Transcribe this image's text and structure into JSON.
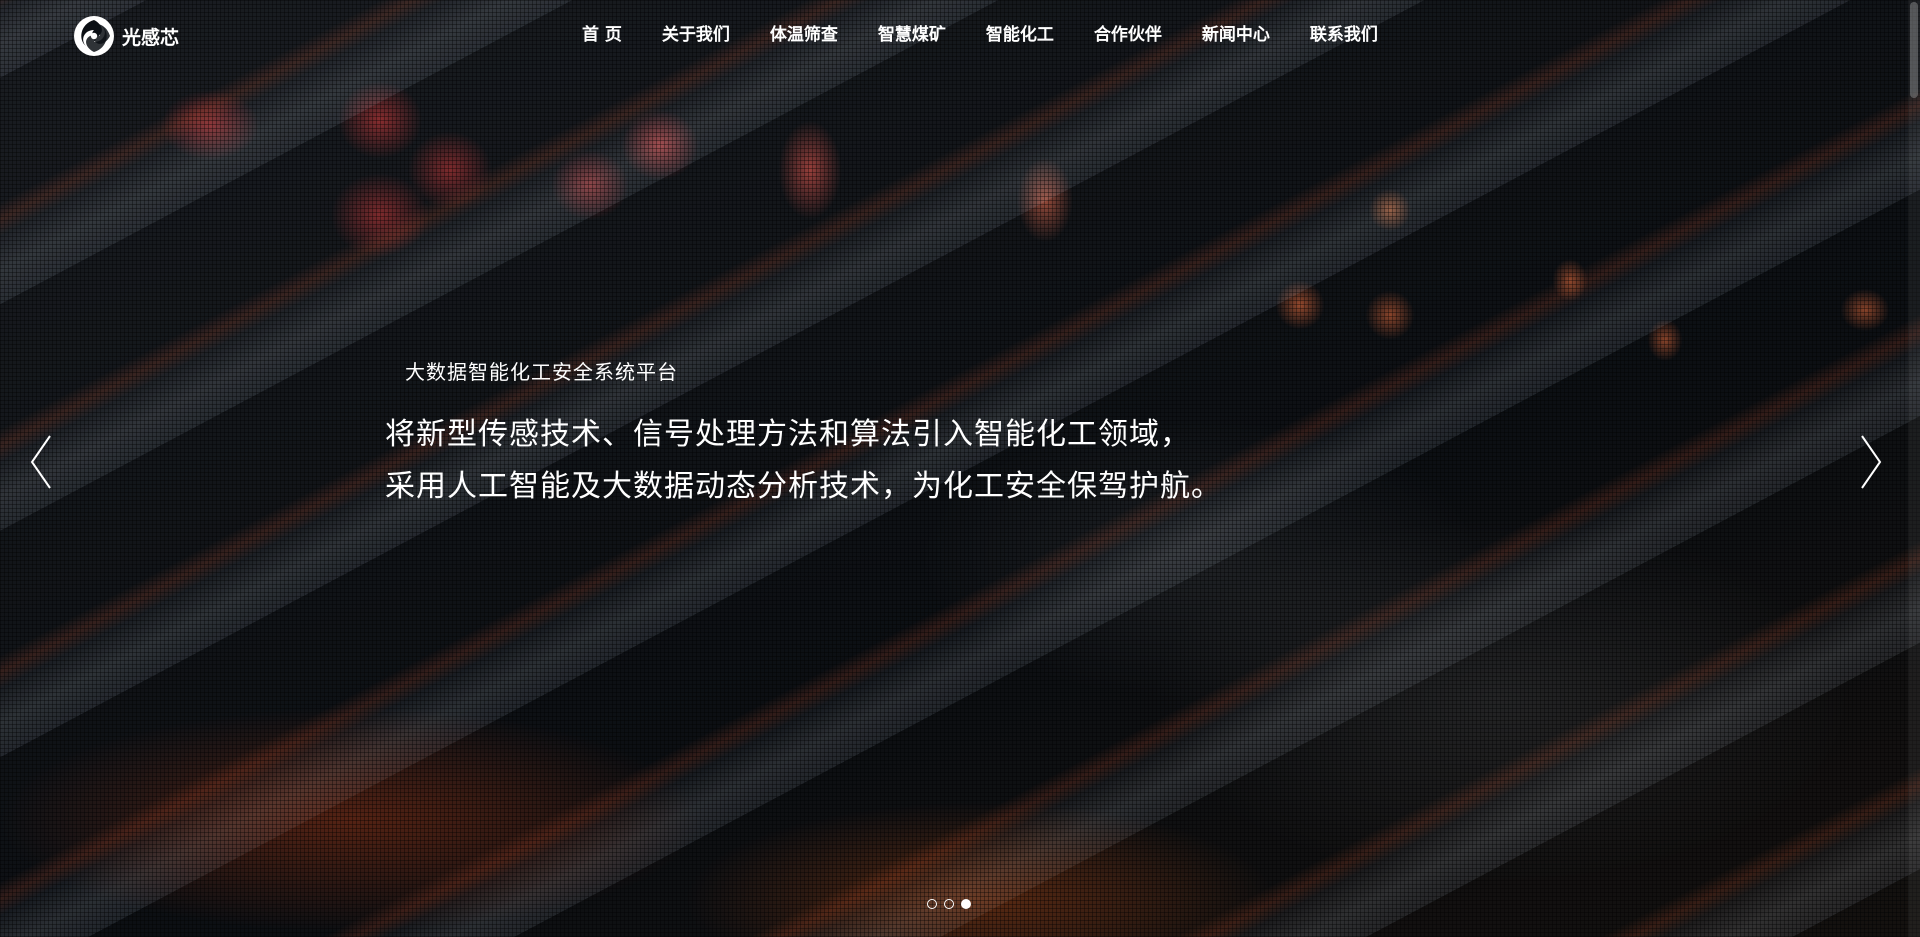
{
  "brand": {
    "name": "光感芯"
  },
  "nav": {
    "items": [
      {
        "label": "首 页"
      },
      {
        "label": "关于我们"
      },
      {
        "label": "体温筛查"
      },
      {
        "label": "智慧煤矿"
      },
      {
        "label": "智能化工"
      },
      {
        "label": "合作伙伴"
      },
      {
        "label": "新闻中心"
      },
      {
        "label": "联系我们"
      }
    ]
  },
  "hero": {
    "subtitle": "大数据智能化工安全系统平台",
    "headline_line1": "将新型传感技术、信号处理方法和算法引入智能化工领域，",
    "headline_line2": "采用人工智能及大数据动态分析技术，为化工安全保驾护航。",
    "prev_icon": "chevron-left-icon",
    "next_icon": "chevron-right-icon"
  },
  "carousel": {
    "slide_count": 3,
    "active_index": 3
  },
  "colors": {
    "text": "#ffffff",
    "accent_glow": "#e04a20"
  }
}
